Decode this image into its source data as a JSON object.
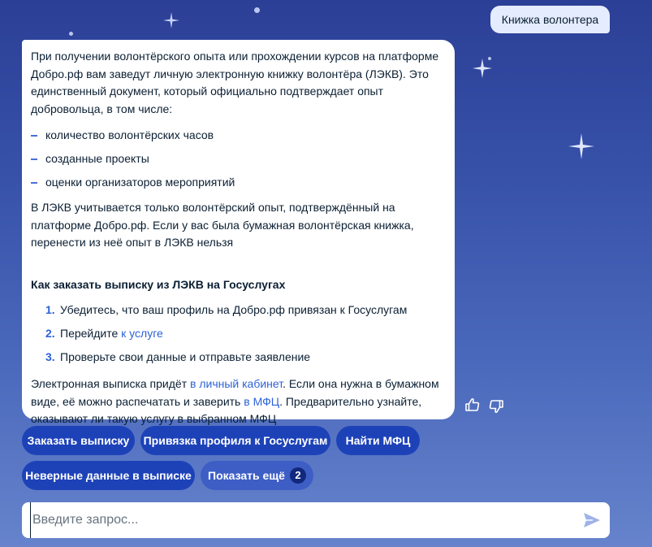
{
  "user_message": "Книжка волонтера",
  "bot_message": {
    "intro": "При получении волонтёрского опыта или прохождении курсов на платформе Добро.рф вам заведут личную электронную книжку волонтёра (ЛЭКВ). Это единственный документ, который официально подтверждает опыт добровольца, в том числе:",
    "bullets": [
      "количество волонтёрских часов",
      "созданные проекты",
      "оценки организаторов мероприятий"
    ],
    "paragraph2": "В ЛЭКВ учитывается только волонтёрский опыт, подтверждённый на платформе Добро.рф. Если у вас была бумажная волонтёрская книжка, перенести из неё опыт в ЛЭКВ нельзя",
    "heading": "Как заказать выписку из ЛЭКВ на Госуслугах",
    "steps": [
      {
        "num": "1.",
        "text": "Убедитесь, что ваш профиль на Добро.рф привязан к Госуслугам",
        "link": ""
      },
      {
        "num": "2.",
        "text": "Перейдите ",
        "link": "к услуге"
      },
      {
        "num": "3.",
        "text": "Проверьте свои данные и отправьте заявление",
        "link": ""
      }
    ],
    "outro": {
      "part1": "Электронная выписка придёт ",
      "link1": "в личный кабинет",
      "part2": ". Если она нужна в бумажном виде, её можно распечатать и заверить ",
      "link2": "в МФЦ",
      "part3": ". Предварительно узнайте, оказывают ли такую услугу в выбранном МФЦ"
    }
  },
  "chips": [
    "Заказать выписку",
    "Привязка профиля к Госуслугам",
    "Найти МФЦ",
    "Неверные данные в выписке"
  ],
  "more_chip": {
    "label": "Показать ещё",
    "count": "2"
  },
  "input": {
    "placeholder": "Введите запрос..."
  },
  "colors": {
    "accent": "#1d42b8",
    "link": "#2d62d8",
    "background": "#3650a8"
  },
  "icons": [
    "thumbs-up-icon",
    "thumbs-down-icon",
    "send-icon",
    "sparkle-icon"
  ]
}
